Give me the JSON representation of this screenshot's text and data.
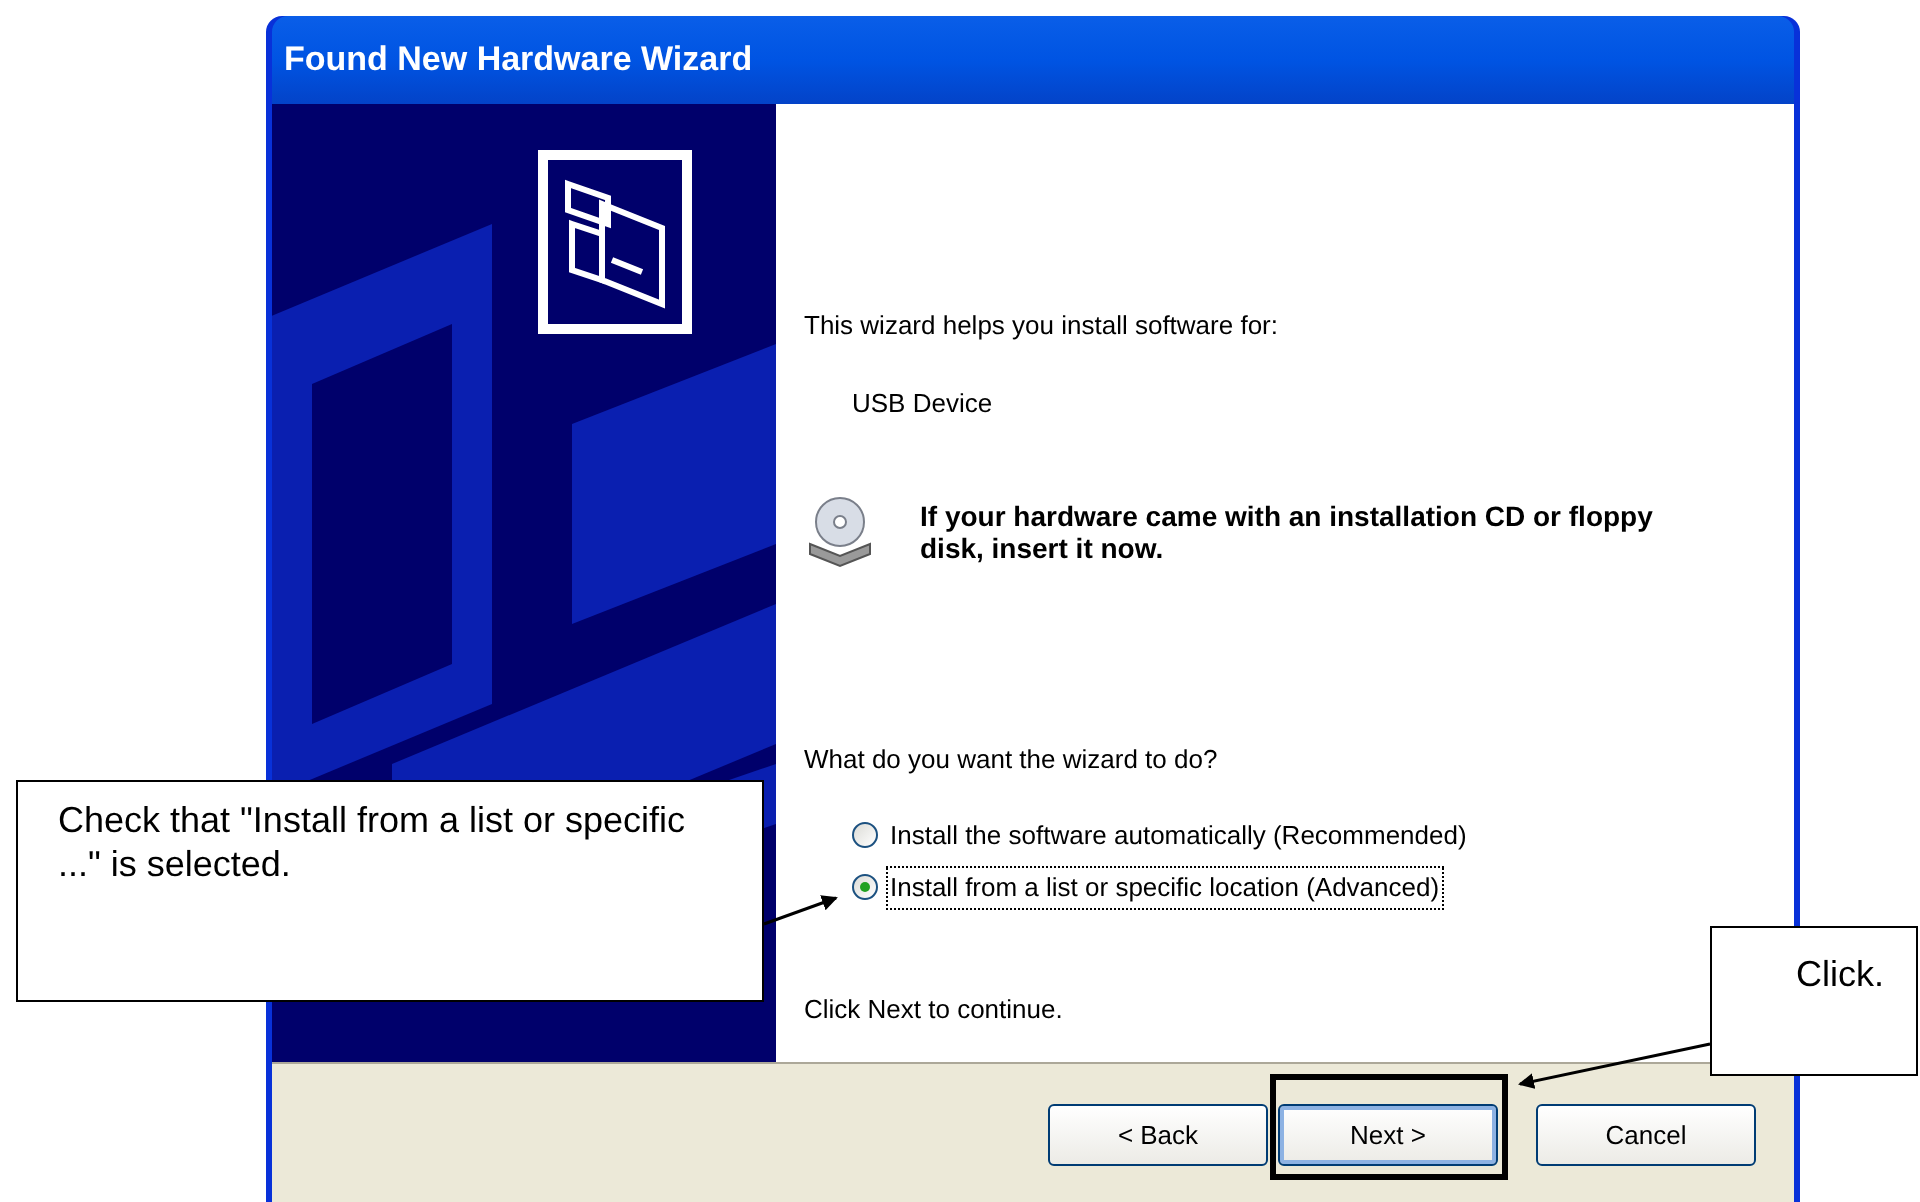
{
  "window": {
    "title": "Found New Hardware Wizard"
  },
  "intro": "This wizard helps you install software for:",
  "device": "USB Device",
  "cd_prompt": "If your hardware came with an installation CD or floppy disk, insert it now.",
  "question": "What do you want the wizard to do?",
  "options": [
    {
      "label": "Install the software automatically (Recommended)",
      "selected": false
    },
    {
      "label": "Install from a list or specific location (Advanced)",
      "selected": true
    }
  ],
  "hint": "Click Next to continue.",
  "buttons": [
    {
      "label": "< Back",
      "default": false,
      "highlighted": false
    },
    {
      "label": "Next >",
      "default": true,
      "highlighted": true
    },
    {
      "label": "Cancel",
      "default": false,
      "highlighted": false
    }
  ],
  "callouts": [
    {
      "kind": "radio",
      "text": "Check that \"Install from a list or specific ...\" is selected."
    },
    {
      "kind": "button",
      "text": "Click."
    }
  ]
}
